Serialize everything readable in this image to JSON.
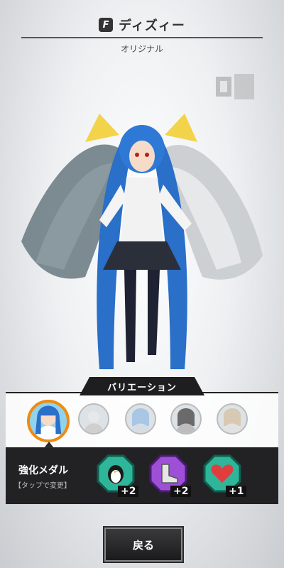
{
  "header": {
    "badge_letter": "F",
    "title": "ディズィー",
    "subtitle": "オリジナル"
  },
  "variation": {
    "tab_label": "バリエーション",
    "items": [
      {
        "name": "variation-1",
        "selected": true
      },
      {
        "name": "variation-2",
        "selected": false
      },
      {
        "name": "variation-3",
        "selected": false
      },
      {
        "name": "variation-4",
        "selected": false
      },
      {
        "name": "variation-5",
        "selected": false
      }
    ]
  },
  "medals": {
    "title": "強化メダル",
    "note": "【タップで変更】",
    "items": [
      {
        "icon": "penguin-icon",
        "count": "+2",
        "color": "#2fb59a"
      },
      {
        "icon": "boot-icon",
        "count": "+2",
        "color": "#9d4fd6"
      },
      {
        "icon": "heart-icon",
        "count": "+1",
        "color": "#2fb59a"
      }
    ]
  },
  "footer": {
    "back_label": "戻る"
  },
  "colors": {
    "accent": "#f08a10",
    "panel": "#222224"
  }
}
